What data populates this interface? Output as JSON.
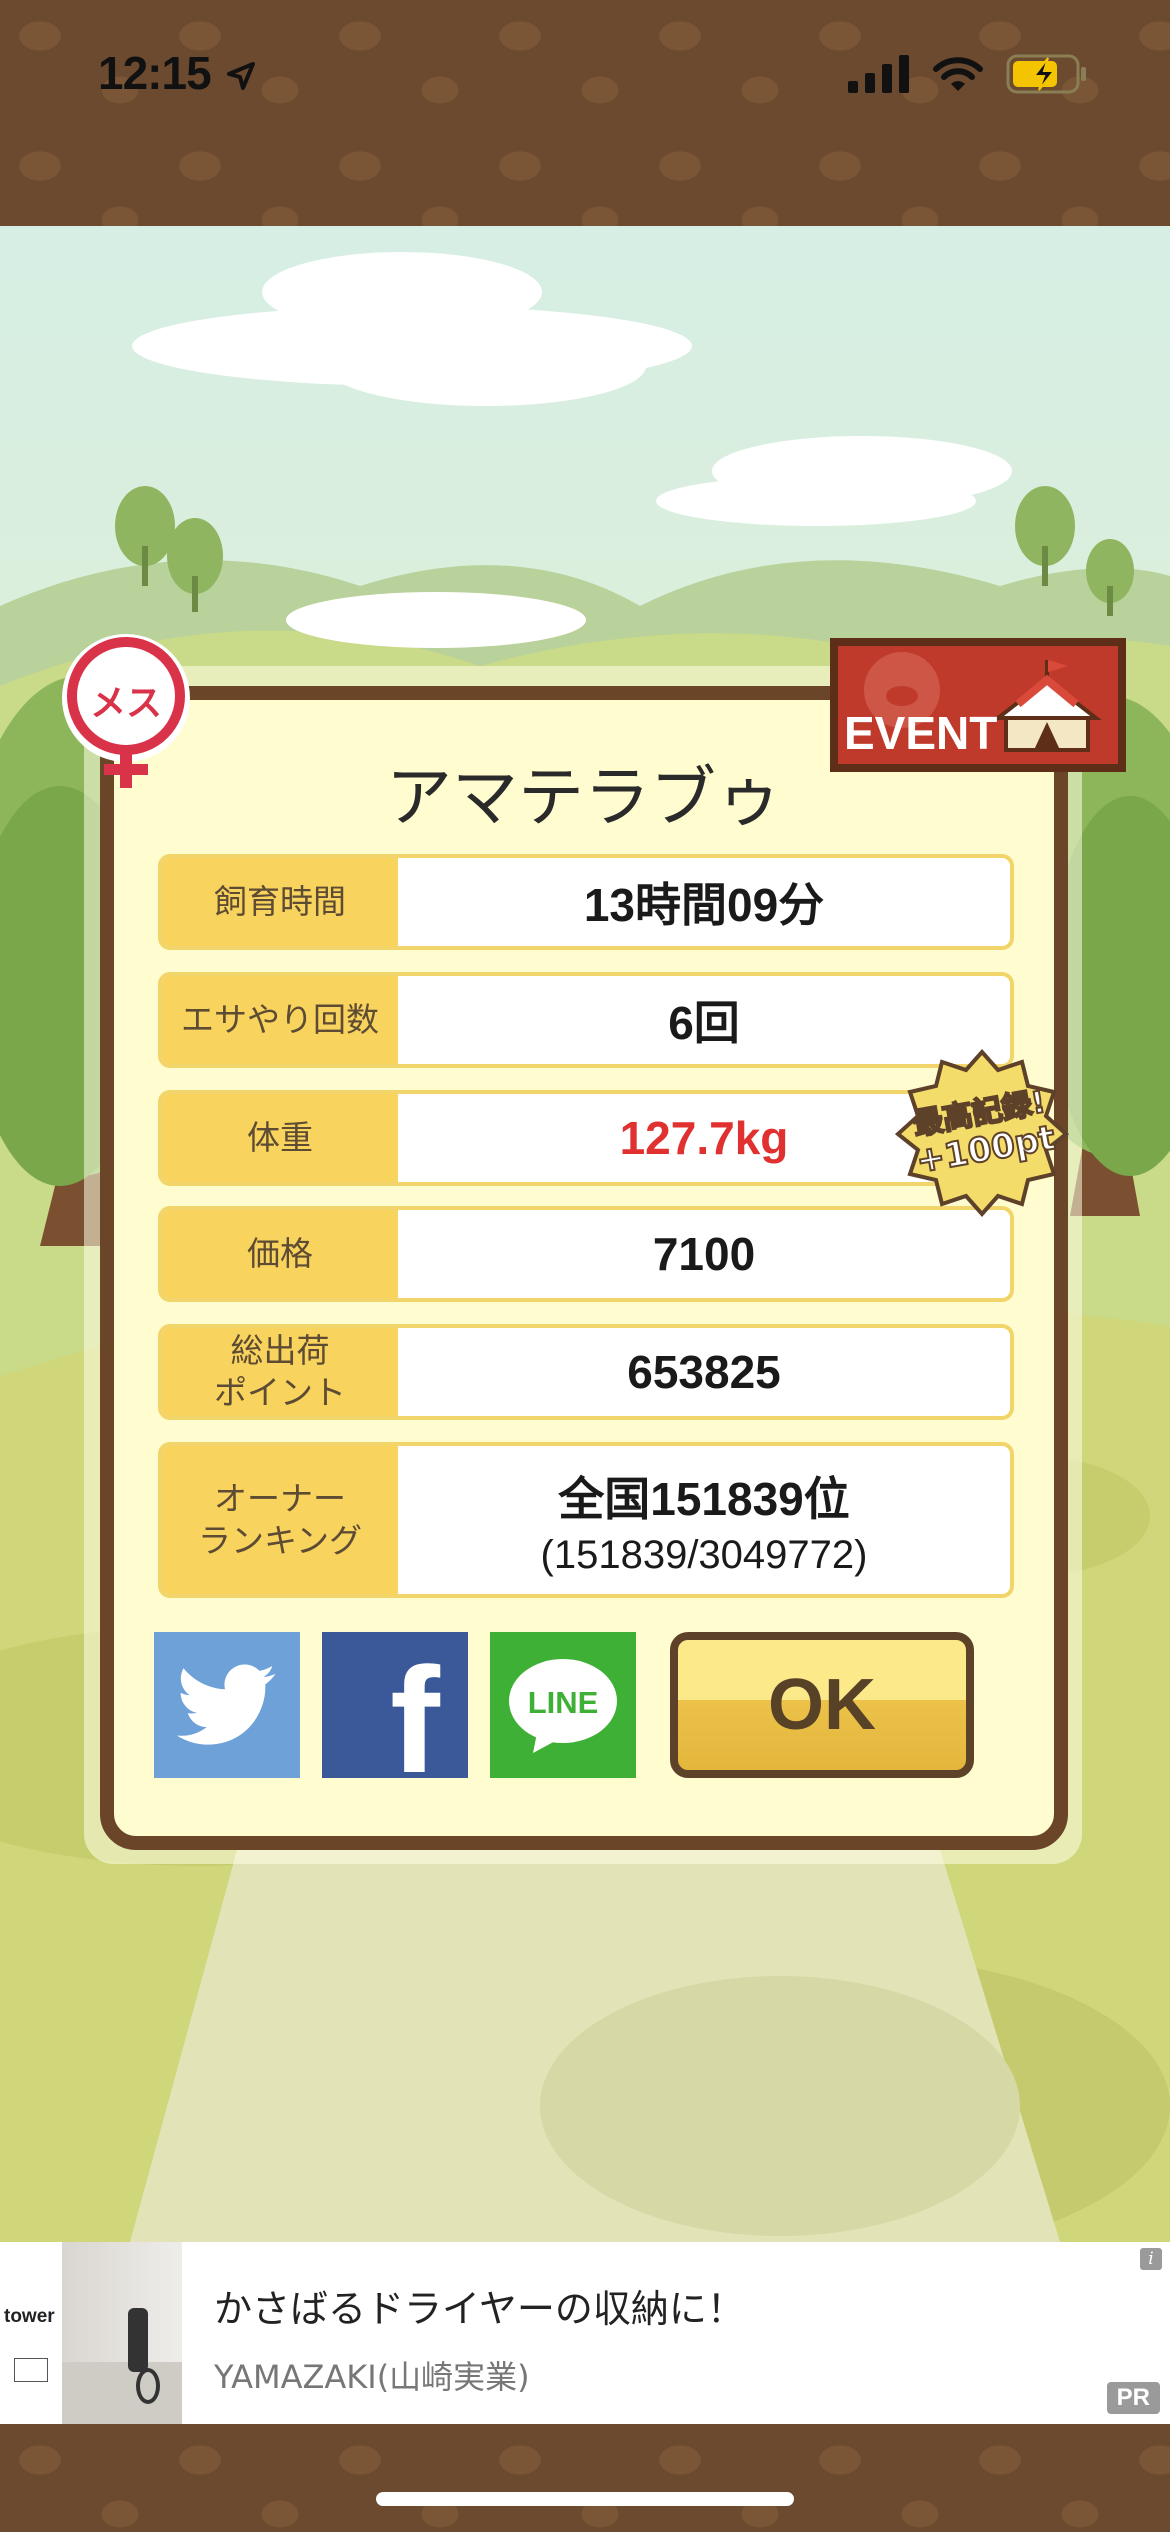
{
  "status_bar": {
    "time": "12:15"
  },
  "pet": {
    "name": "アマテラブゥ",
    "gender_label": "メス"
  },
  "event_badge": {
    "label": "EVENT"
  },
  "record_badge": {
    "line1": "最高記録!",
    "line2": "+100pt"
  },
  "stats": [
    {
      "label": "飼育時間",
      "value": "13時間09分"
    },
    {
      "label": "エサやり回数",
      "value": "6回"
    },
    {
      "label": "体重",
      "value": "127.7kg",
      "highlight": "#e03030"
    },
    {
      "label": "価格",
      "value": "7100"
    },
    {
      "label": "総出荷\nポイント",
      "value": "653825"
    },
    {
      "label": "オーナー\nランキング",
      "value": "全国151839位",
      "sub": "(151839/3049772)"
    }
  ],
  "share": {
    "twitter": {
      "icon": "twitter-bird-icon",
      "color": "#6fa1d9"
    },
    "facebook": {
      "label": "f",
      "color": "#3b5898"
    },
    "line": {
      "label": "LINE",
      "color": "#3eb035"
    }
  },
  "ok_button": {
    "label": "OK"
  },
  "ad": {
    "brand": "tower",
    "title": "かさばるドライヤーの収納に！",
    "advertiser": "YAMAZAKI(山崎実業)",
    "pr_label": "PR",
    "info_label": "i"
  }
}
